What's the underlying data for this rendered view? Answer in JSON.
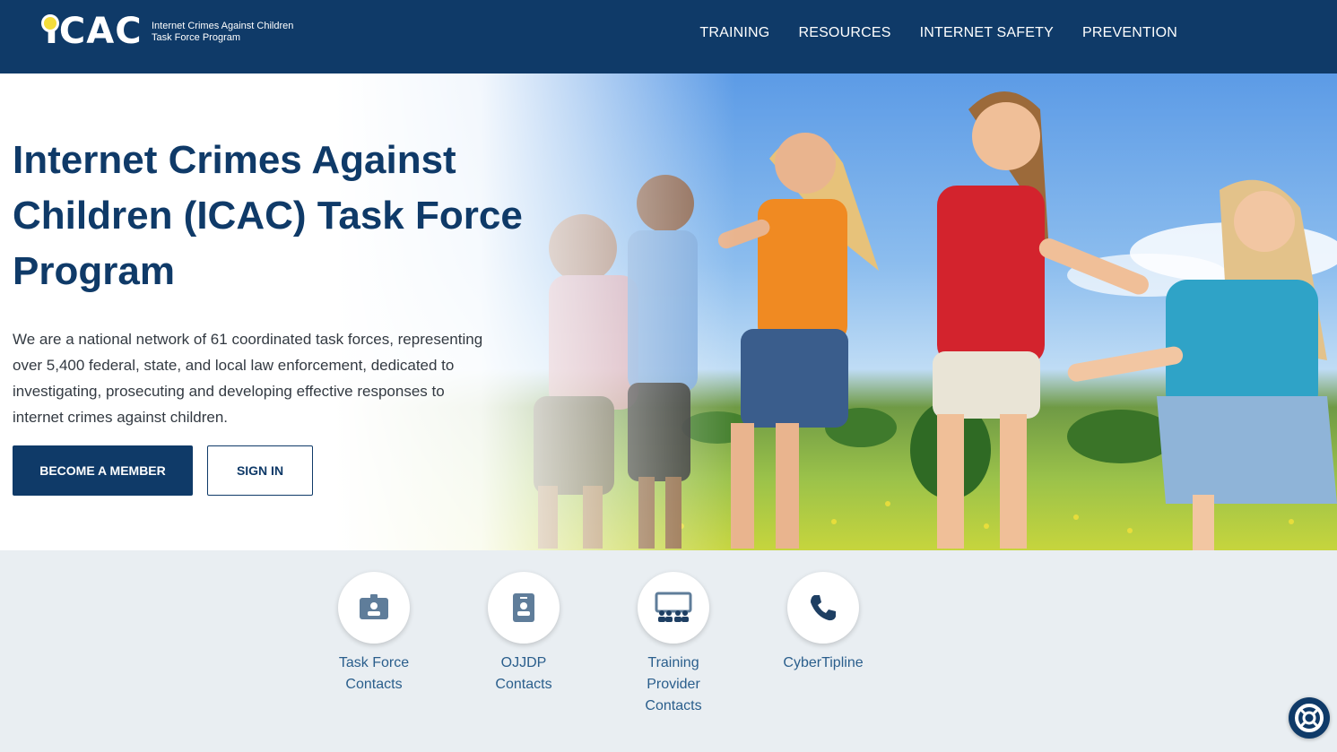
{
  "header": {
    "logo_text": "ICAC",
    "logo_subtitle": "Internet Crimes Against Children Task Force Program",
    "nav": [
      {
        "label": "TRAINING"
      },
      {
        "label": "RESOURCES"
      },
      {
        "label": "INTERNET SAFETY"
      },
      {
        "label": "PREVENTION"
      }
    ]
  },
  "hero": {
    "title": "Internet Crimes Against Children (ICAC) Task Force Program",
    "description": "We are a national network of 61 coordinated task forces, representing over 5,400 federal, state, and local law enforcement, dedicated to investigating, prosecuting and developing effective responses to internet crimes against children.",
    "primary_button": "BECOME A MEMBER",
    "secondary_button": "SIGN IN",
    "image": "children-running-in-field-photo"
  },
  "quick_links": [
    {
      "label": "Task Force Contacts",
      "icon": "id-badge-icon"
    },
    {
      "label": "OJJDP Contacts",
      "icon": "contact-card-icon"
    },
    {
      "label": "Training Provider Contacts",
      "icon": "classroom-icon"
    },
    {
      "label": "CyberTipline",
      "icon": "phone-icon"
    }
  ],
  "help_button": {
    "icon": "lifebuoy-icon"
  },
  "colors": {
    "navy": "#0f3a68",
    "link": "#2a5e8c",
    "logo_accent": "#f5dd3a",
    "background": "#e9eef2"
  }
}
